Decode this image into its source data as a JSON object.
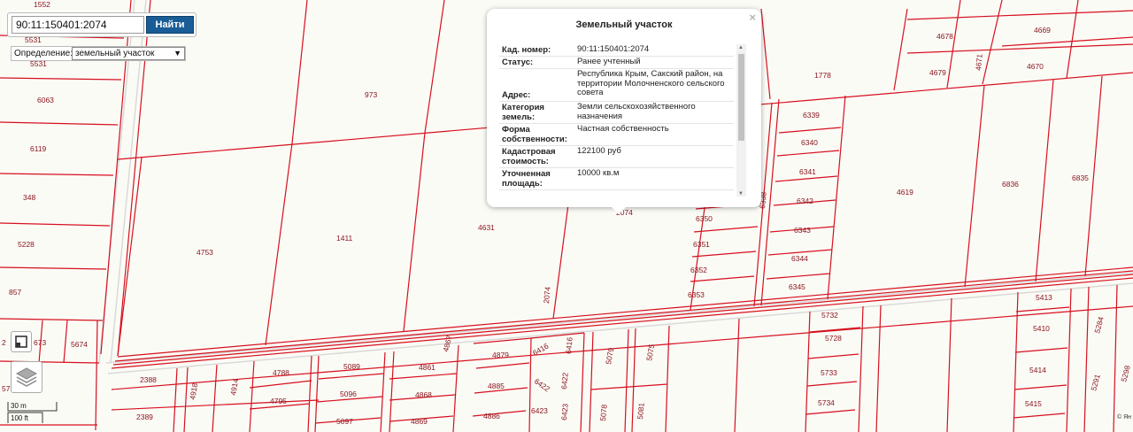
{
  "search": {
    "value": "90:11:150401:2074",
    "button_label": "Найти"
  },
  "definition": {
    "label": "Определение:",
    "selected": "земельный участок"
  },
  "scale": {
    "metric": "30 m",
    "imperial": "100 ft"
  },
  "popup": {
    "title": "Земельный участок",
    "close_symbol": "×",
    "rows": [
      {
        "key": "Кад. номер:",
        "value": "90:11:150401:2074"
      },
      {
        "key": "Статус:",
        "value": "Ранее учтенный"
      },
      {
        "key": "Адрес:",
        "value": "Республика Крым, Сакский район, на территории Молочненского сельского совета"
      },
      {
        "key": "Категория земель:",
        "value": "Земли сельскохозяйственного назначения"
      },
      {
        "key": "Форма собственности:",
        "value": "Частная собственность"
      },
      {
        "key": "Кадастровая стоимость:",
        "value": "122100 руб"
      },
      {
        "key": "Уточненная площадь:",
        "value": "10000 кв.м"
      }
    ]
  },
  "attribution": "© Ян",
  "colors": {
    "parcel_line": "#d6101e",
    "label": "#8a1620",
    "road": "#d9d9d9",
    "button": "#1a5c95",
    "background": "#fbfbf6"
  },
  "icons": {
    "tool_1": "extent-icon",
    "tool_2": "layers-icon"
  },
  "parcel_labels": [
    "1552",
    "5531",
    "5531",
    "6063",
    "6119",
    "348",
    "5228",
    "857",
    "2",
    "673",
    "5674",
    "57",
    "973",
    "4753",
    "1411",
    "4631",
    "2074",
    "2074",
    "1778",
    "4678",
    "4669",
    "4679",
    "4671",
    "4670",
    "6339",
    "6340",
    "6341",
    "6342",
    "6343",
    "6344",
    "6345",
    "6338",
    "6350",
    "6351",
    "6352",
    "6353",
    "4619",
    "6836",
    "6835",
    "5413",
    "5732",
    "5728",
    "5733",
    "5734",
    "5410",
    "5414",
    "5415",
    "5284",
    "5291",
    "5298",
    "2388",
    "2389",
    "4918",
    "4914",
    "4788",
    "4795",
    "5089",
    "5096",
    "5097",
    "4861",
    "4868",
    "4869",
    "4867",
    "4879",
    "4885",
    "4886",
    "6416",
    "6416",
    "6422",
    "6422",
    "6423",
    "6423",
    "5079",
    "5075",
    "5078",
    "5081"
  ]
}
